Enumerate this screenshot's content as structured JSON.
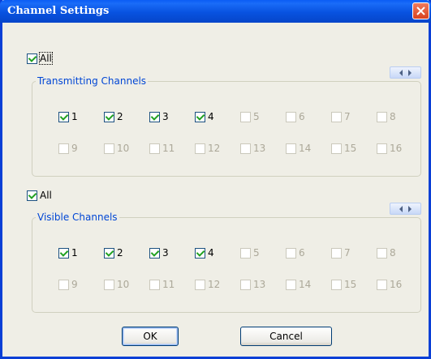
{
  "window": {
    "title": "Channel Settings"
  },
  "transmitting": {
    "all_label": "All",
    "all_checked": true,
    "group_label": "Transmitting Channels",
    "channels": [
      {
        "label": "1",
        "checked": true,
        "enabled": true
      },
      {
        "label": "2",
        "checked": true,
        "enabled": true
      },
      {
        "label": "3",
        "checked": true,
        "enabled": true
      },
      {
        "label": "4",
        "checked": true,
        "enabled": true
      },
      {
        "label": "5",
        "checked": false,
        "enabled": false
      },
      {
        "label": "6",
        "checked": false,
        "enabled": false
      },
      {
        "label": "7",
        "checked": false,
        "enabled": false
      },
      {
        "label": "8",
        "checked": false,
        "enabled": false
      },
      {
        "label": "9",
        "checked": false,
        "enabled": false
      },
      {
        "label": "10",
        "checked": false,
        "enabled": false
      },
      {
        "label": "11",
        "checked": false,
        "enabled": false
      },
      {
        "label": "12",
        "checked": false,
        "enabled": false
      },
      {
        "label": "13",
        "checked": false,
        "enabled": false
      },
      {
        "label": "14",
        "checked": false,
        "enabled": false
      },
      {
        "label": "15",
        "checked": false,
        "enabled": false
      },
      {
        "label": "16",
        "checked": false,
        "enabled": false
      }
    ]
  },
  "visible": {
    "all_label": "All",
    "all_checked": true,
    "group_label": "Visible Channels",
    "channels": [
      {
        "label": "1",
        "checked": true,
        "enabled": true
      },
      {
        "label": "2",
        "checked": true,
        "enabled": true
      },
      {
        "label": "3",
        "checked": true,
        "enabled": true
      },
      {
        "label": "4",
        "checked": true,
        "enabled": true
      },
      {
        "label": "5",
        "checked": false,
        "enabled": false
      },
      {
        "label": "6",
        "checked": false,
        "enabled": false
      },
      {
        "label": "7",
        "checked": false,
        "enabled": false
      },
      {
        "label": "8",
        "checked": false,
        "enabled": false
      },
      {
        "label": "9",
        "checked": false,
        "enabled": false
      },
      {
        "label": "10",
        "checked": false,
        "enabled": false
      },
      {
        "label": "11",
        "checked": false,
        "enabled": false
      },
      {
        "label": "12",
        "checked": false,
        "enabled": false
      },
      {
        "label": "13",
        "checked": false,
        "enabled": false
      },
      {
        "label": "14",
        "checked": false,
        "enabled": false
      },
      {
        "label": "15",
        "checked": false,
        "enabled": false
      },
      {
        "label": "16",
        "checked": false,
        "enabled": false
      }
    ]
  },
  "buttons": {
    "ok": "OK",
    "cancel": "Cancel"
  },
  "colors": {
    "titlebar": "#0852e0",
    "group_label": "#0046d5",
    "disabled_text": "#aca899",
    "close_button": "#d9431f"
  },
  "icons": {
    "close": "close-x-icon",
    "scroll_left": "arrow-left-icon",
    "scroll_right": "arrow-right-icon"
  }
}
